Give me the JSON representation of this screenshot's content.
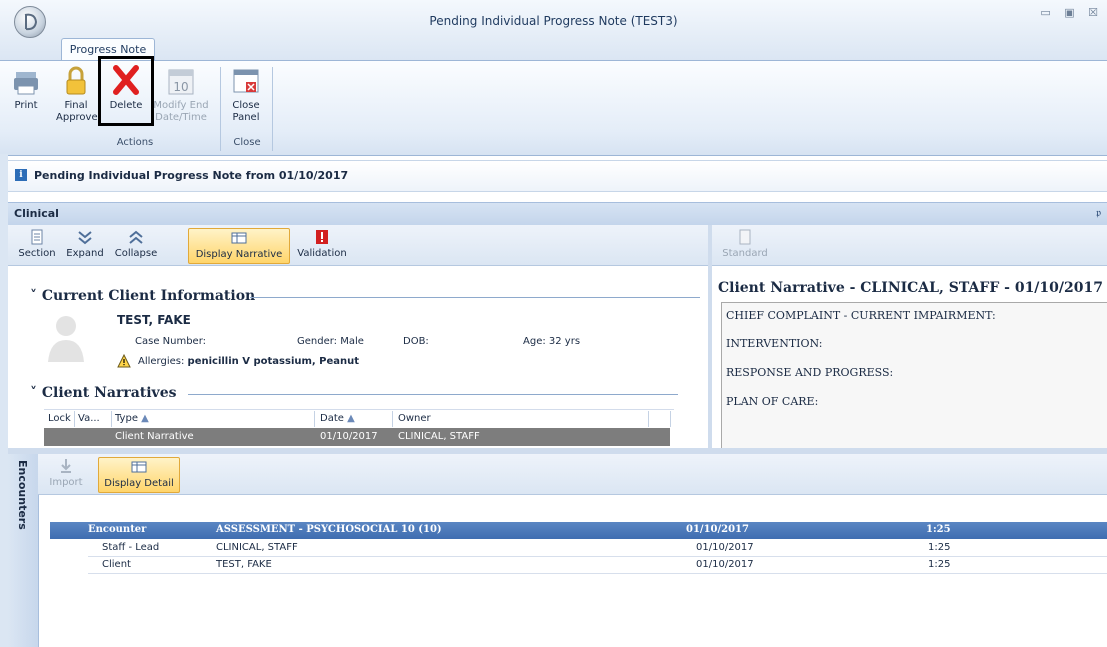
{
  "window": {
    "title": "Pending Individual Progress Note (TEST3)",
    "controls": "▭ ▣ ☒"
  },
  "ribbon": {
    "tab": "Progress Note",
    "buttons": {
      "print": "Print",
      "final_approve_1": "Final",
      "final_approve_2": "Approve",
      "delete": "Delete",
      "modify_end_1": "Modify End",
      "modify_end_2": "Date/Time",
      "close_panel_1": "Close",
      "close_panel_2": "Panel"
    },
    "groups": {
      "actions": "Actions",
      "close": "Close"
    },
    "calendar_day": "10"
  },
  "info_bar": {
    "text": "Pending Individual Progress Note from 01/10/2017"
  },
  "clinical": {
    "title": "Clinical",
    "toolbar": {
      "section": "Section",
      "expand": "Expand",
      "collapse": "Collapse",
      "display_narrative": "Display Narrative",
      "validation": "Validation",
      "standard": "Standard"
    },
    "client_info": {
      "heading": "Current Client Information",
      "name": "TEST, FAKE",
      "case_number_label": "Case Number:",
      "gender": "Gender: Male",
      "dob_label": "DOB:",
      "age": "Age: 32 yrs",
      "allergies_label": "Allergies:",
      "allergies_value": "penicillin V potassium, Peanut"
    },
    "narratives": {
      "heading": "Client Narratives",
      "columns": {
        "lock": "Lock",
        "va": "Va...",
        "type": "Type",
        "date": "Date",
        "owner": "Owner"
      },
      "rows": [
        {
          "type": "Client Narrative",
          "date": "01/10/2017",
          "owner": "CLINICAL, STAFF"
        }
      ]
    },
    "narrative_pane": {
      "title": "Client Narrative - CLINICAL, STAFF - 01/10/2017",
      "lines": [
        "CHIEF COMPLAINT - CURRENT IMPAIRMENT:",
        "INTERVENTION:",
        "RESPONSE AND PROGRESS:",
        "PLAN OF CARE:"
      ]
    }
  },
  "encounters": {
    "title": "Encounters",
    "toolbar": {
      "import": "Import",
      "display_detail": "Display Detail"
    },
    "header": {
      "label": "Encounter",
      "service": "ASSESSMENT - PSYCHOSOCIAL 10 (10)",
      "date": "01/10/2017",
      "duration": "1:25"
    },
    "rows": [
      {
        "role": "Staff - Lead",
        "name": "CLINICAL, STAFF",
        "date": "01/10/2017",
        "duration": "1:25"
      },
      {
        "role": "Client",
        "name": "TEST, FAKE",
        "date": "01/10/2017",
        "duration": "1:25"
      }
    ]
  },
  "colors": {
    "accent_blue": "#3f6db0",
    "highlight_yellow": "#ffd56b",
    "selected_row": "#7d7d7d",
    "delete_red": "#e02020"
  }
}
